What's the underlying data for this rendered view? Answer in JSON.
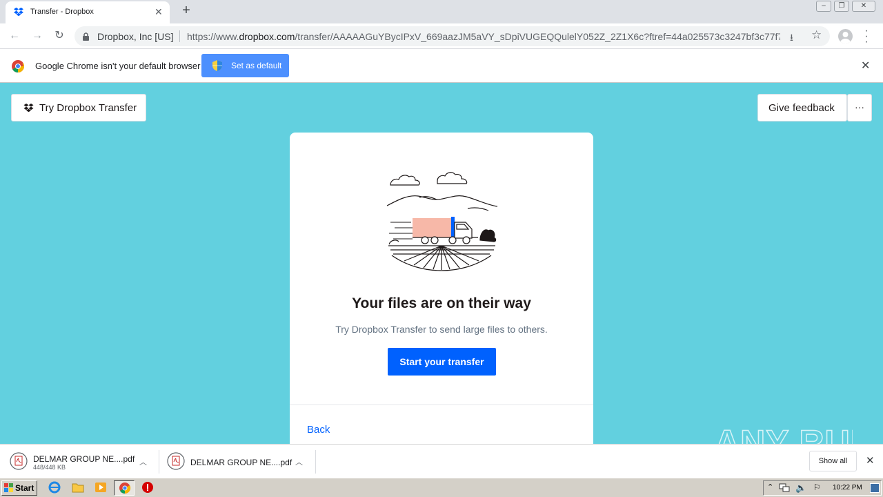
{
  "browser": {
    "tab_title": "Transfer - Dropbox",
    "origin": "Dropbox, Inc [US]",
    "url_prefix": "https://www.",
    "url_domain": "dropbox.com",
    "url_rest": "/transfer/AAAAAGuYBycIPxV_669aazJM5aVY_sDpiVUGEQQulelY052Z_2Z1X6c?ftref=44a025573c3247bf3c77f7..."
  },
  "infobar": {
    "message": "Google Chrome isn't your default browser",
    "set_default_label": "Set as default"
  },
  "page": {
    "try_button_label": "Try Dropbox Transfer",
    "feedback_label": "Give feedback",
    "more_label": "···",
    "heading": "Your files are on their way",
    "subtext": "Try Dropbox Transfer to send large files to others.",
    "start_button_label": "Start your transfer",
    "back_label": "Back"
  },
  "watermark": "ANY RUN",
  "downloads": [
    {
      "name": "DELMAR GROUP NE....pdf",
      "size": "448/448 KB"
    },
    {
      "name": "DELMAR GROUP NE....pdf"
    }
  ],
  "download_shelf": {
    "show_all_label": "Show all"
  },
  "taskbar": {
    "start_label": "Start",
    "clock": "10:22 PM"
  },
  "colors": {
    "page_bg": "#62d0df",
    "primary": "#0061fe",
    "chrome_blue": "#4d90fe"
  }
}
